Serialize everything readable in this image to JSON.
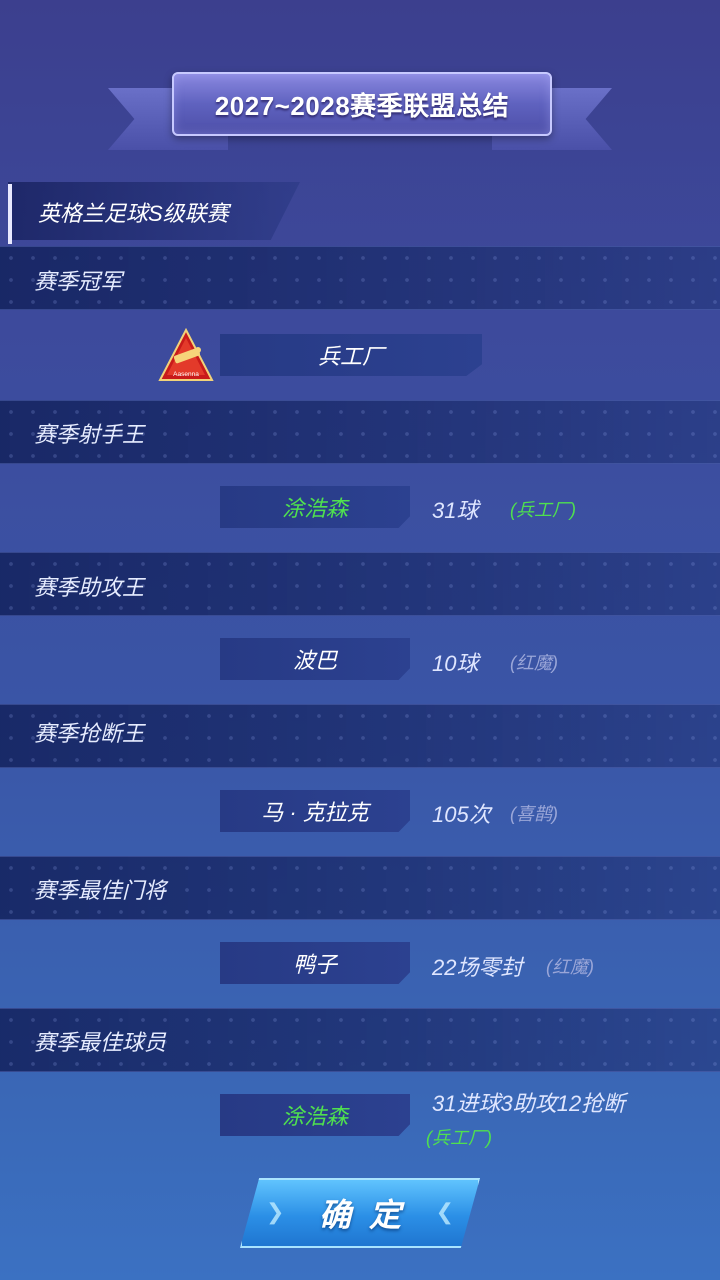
{
  "title": "2027~2028赛季联盟总结",
  "league": "英格兰足球S级联赛",
  "sections": [
    {
      "label": "赛季冠军",
      "value": "兵工厂",
      "crest_text": "Aasenna"
    },
    {
      "label": "赛季射手王",
      "player": "涂浩森",
      "stat": "31球",
      "team": "(兵工厂)"
    },
    {
      "label": "赛季助攻王",
      "player": "波巴",
      "stat": "10球",
      "team": "(红魔)"
    },
    {
      "label": "赛季抢断王",
      "player": "马 · 克拉克",
      "stat": "105次",
      "team": "(喜鹊)"
    },
    {
      "label": "赛季最佳门将",
      "player": "鸭子",
      "stat": "22场零封",
      "team": "(红魔)"
    },
    {
      "label": "赛季最佳球员",
      "player": "涂浩森",
      "stat": "31进球3助攻12抢断",
      "team": "(兵工厂)"
    }
  ],
  "confirm_label": "确定",
  "colors": {
    "highlight_green": "#4fe04f",
    "button_blue": "#2b8fe6"
  }
}
